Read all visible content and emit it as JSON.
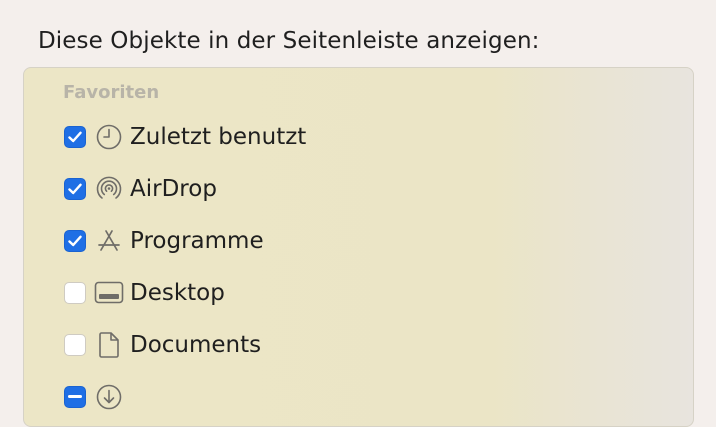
{
  "heading": "Diese Objekte in der Seitenleiste anzeigen:",
  "favorites": {
    "section_label": "Favoriten",
    "items": [
      {
        "label": "Zuletzt benutzt",
        "checked": true,
        "icon": "clock-icon"
      },
      {
        "label": "AirDrop",
        "checked": true,
        "icon": "airdrop-icon"
      },
      {
        "label": "Programme",
        "checked": true,
        "icon": "applications-icon"
      },
      {
        "label": "Desktop",
        "checked": false,
        "icon": "desktop-icon"
      },
      {
        "label": "Documents",
        "checked": false,
        "icon": "document-icon"
      },
      {
        "label": "",
        "checked": "mixed",
        "icon": "downloads-icon"
      }
    ]
  },
  "colors": {
    "accent": "#1f6fe5",
    "panel_background": "#ebe5c6",
    "window_background": "#f4efec"
  }
}
